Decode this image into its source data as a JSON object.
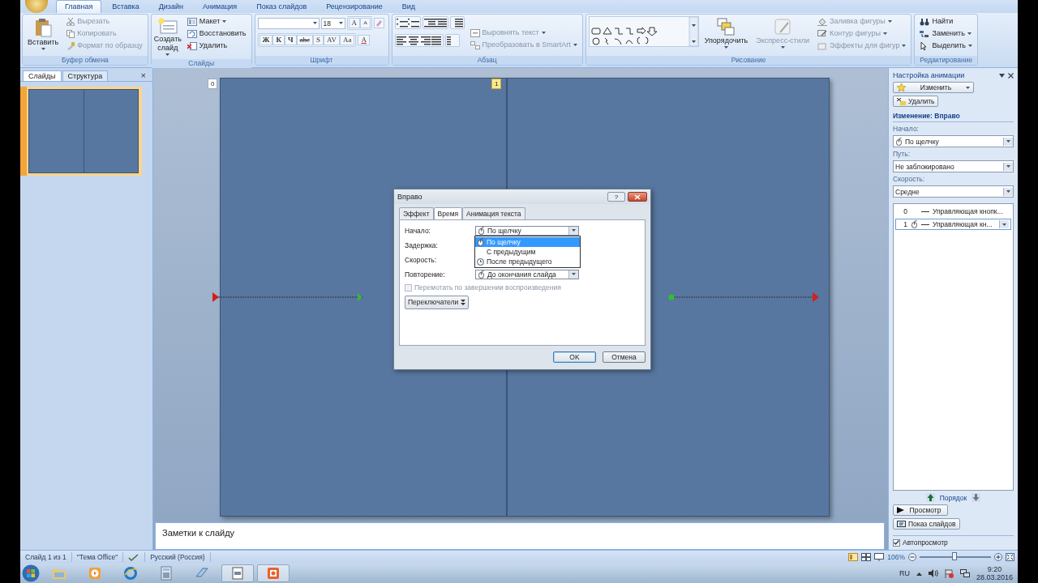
{
  "app_tabs": [
    {
      "label": "Главная",
      "selected": true
    },
    {
      "label": "Вставка",
      "selected": false
    },
    {
      "label": "Дизайн",
      "selected": false
    },
    {
      "label": "Анимация",
      "selected": false
    },
    {
      "label": "Показ слайдов",
      "selected": false
    },
    {
      "label": "Рецензирование",
      "selected": false
    },
    {
      "label": "Вид",
      "selected": false
    }
  ],
  "ribbon": {
    "clipboard": {
      "label": "Буфер обмена",
      "paste": "Вставить",
      "cut": "Вырезать",
      "copy": "Копировать",
      "painter": "Формат по образцу"
    },
    "slides": {
      "label": "Слайды",
      "new_slide": "Создать слайд",
      "layout": "Макет",
      "reset": "Восстановить",
      "delete": "Удалить"
    },
    "font": {
      "label": "Шрифт",
      "size": "18",
      "grow": "A",
      "shrink": "A",
      "styles": [
        "Ж",
        "К",
        "Ч",
        "abe",
        "S",
        "AV",
        "Aa"
      ],
      "color_button": "A"
    },
    "paragraph": {
      "label": "Абзац",
      "align_text": "Выровнять текст",
      "smartart": "Преобразовать в SmartArt"
    },
    "drawing": {
      "label": "Рисование",
      "arrange": "Упорядочить",
      "quick_styles": "Экспресс-стили",
      "fill": "Заливка фигуры",
      "outline": "Контур фигуры",
      "effects": "Эффекты для фигур"
    },
    "editing": {
      "label": "Редактирование",
      "find": "Найти",
      "replace": "Заменить",
      "select": "Выделить"
    }
  },
  "slide_panel": {
    "tabs": [
      {
        "label": "Слайды",
        "selected": true
      },
      {
        "label": "Структура",
        "selected": false
      }
    ],
    "close": "×",
    "thumbnails": [
      {
        "selected": true
      }
    ]
  },
  "slide": {
    "badges": [
      {
        "label": "0",
        "selected": false
      },
      {
        "label": "1",
        "selected": true
      }
    ]
  },
  "dialog": {
    "title": "Вправо",
    "help": "?",
    "tabs": [
      {
        "label": "Эффект",
        "selected": false
      },
      {
        "label": "Время",
        "selected": true
      },
      {
        "label": "Анимация текста",
        "selected": false
      }
    ],
    "fields": [
      {
        "label": "Начало:",
        "value": "По щелчку"
      },
      {
        "label": "Задержка:"
      },
      {
        "label": "Скорость:"
      },
      {
        "label": "Повторение:",
        "value": "До окончания слайда"
      }
    ],
    "options": [
      {
        "label": "По щелчку",
        "selected": true
      },
      {
        "label": "С предыдущим",
        "selected": false
      },
      {
        "label": "После предыдущего",
        "selected": false
      }
    ],
    "rewind": {
      "label": "Перемотать по завершении воспроизведения",
      "checked": false,
      "disabled": true
    },
    "triggers": "Переключатели",
    "ok": "OK",
    "cancel": "Отмена"
  },
  "notes": {
    "text": "Заметки к слайду"
  },
  "animation_pane": {
    "title": "Настройка анимации",
    "change": "Изменить",
    "remove": "Удалить",
    "heading": "Изменение: Вправо",
    "fields": [
      {
        "label": "Начало:",
        "value": "По щелчку"
      },
      {
        "label": "Путь:",
        "value": "Не заблокировано"
      },
      {
        "label": "Скорость:",
        "value": "Средне"
      }
    ],
    "effects": [
      {
        "number": "0",
        "label": "Управляющая кнопк...",
        "selected": false
      },
      {
        "number": "1",
        "label": "Управляющая кн...",
        "selected": true
      }
    ],
    "order": "Порядок",
    "play": "Просмотр",
    "slide_show": "Показ слайдов",
    "autopreview": {
      "label": "Автопросмотр",
      "checked": true
    }
  },
  "status_bar": {
    "slide": "Слайд 1 из 1",
    "theme": "\"Тема Office\"",
    "language": "Русский (Россия)",
    "zoom": "106%",
    "zoom_slider": {
      "level": 0.5
    }
  },
  "taskbar": {
    "language": "RU",
    "time": "9:20",
    "date": "28.03.2016"
  }
}
